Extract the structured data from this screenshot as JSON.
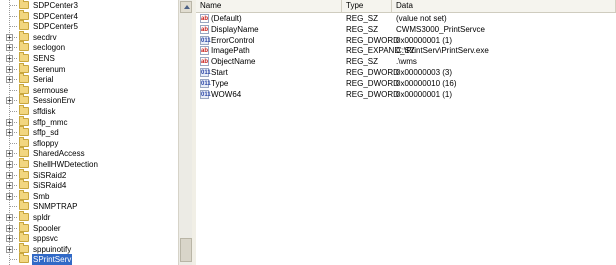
{
  "tree": {
    "items": [
      {
        "label": "SDPCenter3",
        "expandable": false
      },
      {
        "label": "SDPCenter4",
        "expandable": false
      },
      {
        "label": "SDPCenter5",
        "expandable": false
      },
      {
        "label": "secdrv",
        "expandable": true
      },
      {
        "label": "seclogon",
        "expandable": true
      },
      {
        "label": "SENS",
        "expandable": true
      },
      {
        "label": "Serenum",
        "expandable": true
      },
      {
        "label": "Serial",
        "expandable": true
      },
      {
        "label": "sermouse",
        "expandable": false
      },
      {
        "label": "SessionEnv",
        "expandable": true
      },
      {
        "label": "sffdisk",
        "expandable": false
      },
      {
        "label": "sffp_mmc",
        "expandable": true
      },
      {
        "label": "sffp_sd",
        "expandable": true
      },
      {
        "label": "sfloppy",
        "expandable": false
      },
      {
        "label": "SharedAccess",
        "expandable": true
      },
      {
        "label": "ShellHWDetection",
        "expandable": true
      },
      {
        "label": "SiSRaid2",
        "expandable": true
      },
      {
        "label": "SiSRaid4",
        "expandable": true
      },
      {
        "label": "Smb",
        "expandable": true
      },
      {
        "label": "SNMPTRAP",
        "expandable": false
      },
      {
        "label": "spldr",
        "expandable": true
      },
      {
        "label": "Spooler",
        "expandable": true
      },
      {
        "label": "sppsvc",
        "expandable": true
      },
      {
        "label": "sppuinotify",
        "expandable": true
      },
      {
        "label": "SPrintServ",
        "expandable": false,
        "selected": true
      }
    ]
  },
  "list": {
    "columns": {
      "name": "Name",
      "type": "Type",
      "data": "Data"
    },
    "rows": [
      {
        "icon": "string-value-icon",
        "name": "(Default)",
        "type": "REG_SZ",
        "data": "(value not set)"
      },
      {
        "icon": "string-value-icon",
        "name": "DisplayName",
        "type": "REG_SZ",
        "data": "CWMS3000_PrintServce"
      },
      {
        "icon": "binary-value-icon",
        "name": "ErrorControl",
        "type": "REG_DWORD",
        "data": "0x00000001 (1)"
      },
      {
        "icon": "string-value-icon",
        "name": "ImagePath",
        "type": "REG_EXPAND_SZ",
        "data": "C:\\PrintServ\\PrintServ.exe"
      },
      {
        "icon": "string-value-icon",
        "name": "ObjectName",
        "type": "REG_SZ",
        "data": ".\\wms"
      },
      {
        "icon": "binary-value-icon",
        "name": "Start",
        "type": "REG_DWORD",
        "data": "0x00000003 (3)"
      },
      {
        "icon": "binary-value-icon",
        "name": "Type",
        "type": "REG_DWORD",
        "data": "0x00000010 (16)"
      },
      {
        "icon": "binary-value-icon",
        "name": "WOW64",
        "type": "REG_DWORD",
        "data": "0x00000001 (1)"
      }
    ]
  },
  "icon_glyphs": {
    "string-value-icon": "ab",
    "binary-value-icon": "011"
  }
}
